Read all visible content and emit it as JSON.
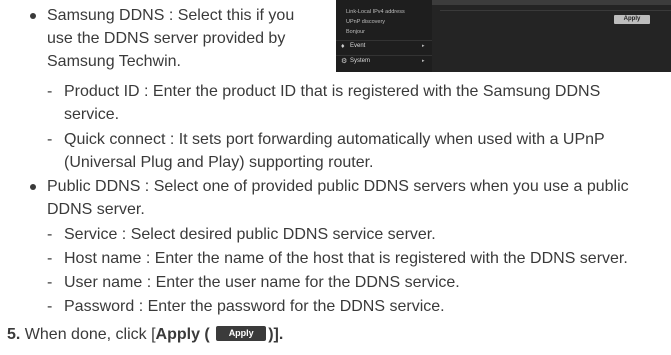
{
  "document": {
    "samsung_ddns": {
      "lines": [
        "Samsung DDNS : Select this if you",
        "use the DDNS server provided by",
        "Samsung Techwin."
      ]
    },
    "product_id": {
      "lines": [
        "Product ID : Enter the product ID that is registered with the Samsung DDNS",
        "service."
      ]
    },
    "quick_connect": {
      "lines": [
        "Quick connect : It sets port forwarding automatically when used with a UPnP",
        "(Universal Plug and Play) supporting router."
      ]
    },
    "public_ddns": {
      "lines": [
        "Public DDNS : Select one of provided public DDNS servers when you use a public",
        "DDNS server."
      ]
    },
    "service": "Service : Select desired public DDNS service server.",
    "host_name": "Host name : Enter the name of the host that is registered with the DDNS server.",
    "user_name": "User name : Enter the user name for the DDNS service.",
    "password": "Password : Enter the password for the DDNS service.",
    "step5": {
      "number": "5.",
      "before": "When done, click [",
      "bold": "Apply (",
      "after": ")]."
    },
    "dash_glyph": "-"
  },
  "screenshot": {
    "submenu": [
      "Link-Local IPv4 address",
      "UPnP discovery",
      "Bonjour"
    ],
    "menu": [
      {
        "label": "Event",
        "icon": "bell-icon",
        "arrow": "▸"
      },
      {
        "label": "System",
        "icon": "gear-icon",
        "arrow": "▸"
      }
    ],
    "apply_label": "Apply"
  },
  "inline_apply_label": "Apply"
}
